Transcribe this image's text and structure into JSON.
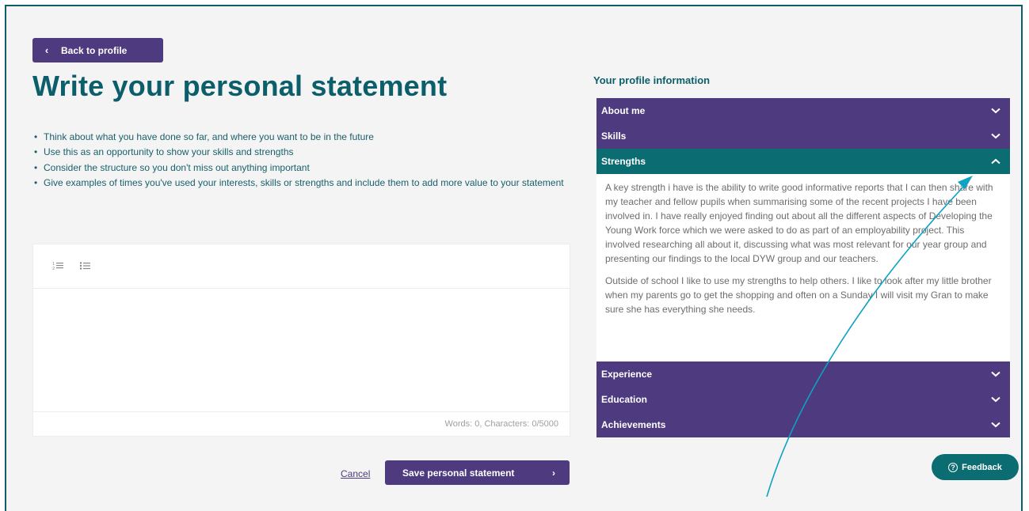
{
  "back_button": {
    "label": "Back to profile"
  },
  "page": {
    "title": "Write your personal statement",
    "tips": [
      "Think about what you have done so far, and where you want to be in the future",
      "Use this as an opportunity to show your skills and strengths",
      "Consider the structure so you don't miss out anything important",
      "Give examples of times you've used your interests, skills or strengths and include them to add more value to your statement"
    ]
  },
  "editor": {
    "toolbar": [
      {
        "icon": "numbered-list-icon"
      },
      {
        "icon": "bulleted-list-icon"
      }
    ],
    "text": "",
    "counter": "Words: 0, Characters: 0/5000"
  },
  "actions": {
    "cancel_label": "Cancel",
    "save_label": "Save personal statement"
  },
  "profile": {
    "title": "Your profile information",
    "sections": [
      {
        "label": "About me",
        "expanded": false
      },
      {
        "label": "Skills",
        "expanded": false
      },
      {
        "label": "Strengths",
        "expanded": true,
        "content": [
          "A key strength i have is the ability to write good informative reports that I can then share with my teacher and fellow pupils when summarising some of the recent projects I have been involved in.  I have really enjoyed finding out about all the different aspects of Developing the Young Work force which we were asked to do as part of an employability project.  This involved researching  all about it, discussing what was most relevant for our year group and presenting our findings to the local DYW group and our teachers.",
          "Outside of school I like to use my strengths to help others.  I like to look after my little brother when my parents go to get the shopping and often on a Sunday I will visit my Gran to make sure she has everything she needs."
        ]
      },
      {
        "label": "Experience",
        "expanded": false
      },
      {
        "label": "Education",
        "expanded": false
      },
      {
        "label": "Achievements",
        "expanded": false
      }
    ]
  },
  "feedback": {
    "label": "Feedback"
  },
  "colors": {
    "primary_purple": "#4e3a7e",
    "teal": "#0b6c72",
    "heading_teal": "#0b5e6a",
    "annotation_arrow": "#0ba2c4"
  }
}
